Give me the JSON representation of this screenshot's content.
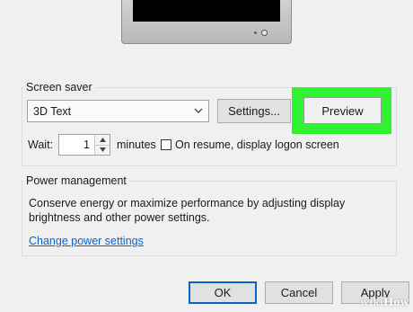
{
  "screen_saver": {
    "group_title": "Screen saver",
    "dropdown_value": "3D Text",
    "settings_label": "Settings...",
    "preview_label": "Preview",
    "wait_label": "Wait:",
    "wait_value": "1",
    "minutes_label": "minutes",
    "on_resume_label": "On resume, display logon screen",
    "on_resume_checked": false,
    "highlight_color": "#2ef32e"
  },
  "power": {
    "group_title": "Power management",
    "description_line1": "Conserve energy or maximize performance by adjusting display",
    "description_line2": "brightness and other power settings.",
    "link_label": "Change power settings"
  },
  "footer": {
    "ok_label": "OK",
    "cancel_label": "Cancel",
    "apply_label": "Apply"
  },
  "watermark": {
    "wiki": "wiki",
    "how": "How"
  }
}
